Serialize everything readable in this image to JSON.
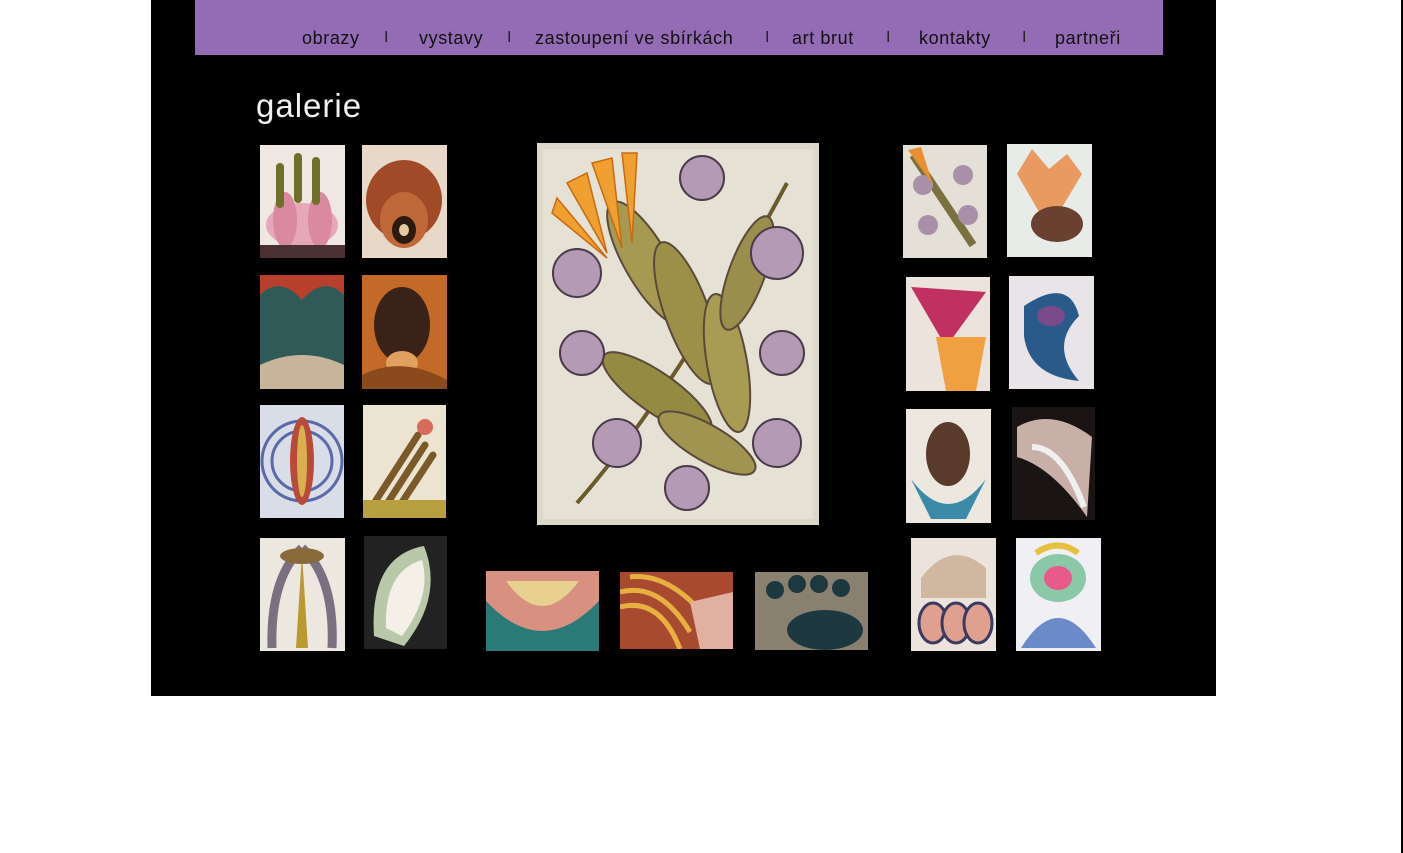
{
  "nav": {
    "items": [
      {
        "label": "obrazy"
      },
      {
        "label": "vystavy"
      },
      {
        "label": "zastoupení ve sbírkách"
      },
      {
        "label": "art brut"
      },
      {
        "label": "kontakty"
      },
      {
        "label": "partneři"
      }
    ],
    "separator": "I"
  },
  "page": {
    "title": "galerie"
  },
  "colors": {
    "nav_bg": "#946cb6",
    "frame_bg": "#000000",
    "title_text": "#f2f2f2"
  }
}
